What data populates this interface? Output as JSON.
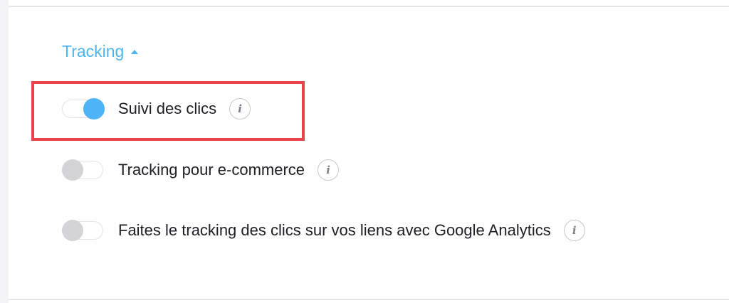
{
  "section": {
    "title": "Tracking",
    "expanded": true
  },
  "options": [
    {
      "label": "Suivi des clics",
      "enabled": true,
      "info_icon": "info-icon"
    },
    {
      "label": "Tracking pour e-commerce",
      "enabled": false,
      "info_icon": "info-icon"
    },
    {
      "label": "Faites le tracking des clics sur vos liens avec Google Analytics",
      "enabled": false,
      "info_icon": "info-icon"
    }
  ],
  "info_glyph": "i",
  "colors": {
    "accent": "#4db4f0",
    "toggle_on": "#4db4f7",
    "toggle_off": "#d4d4d6",
    "highlight": "#e8434a",
    "text": "#1e1e24"
  }
}
